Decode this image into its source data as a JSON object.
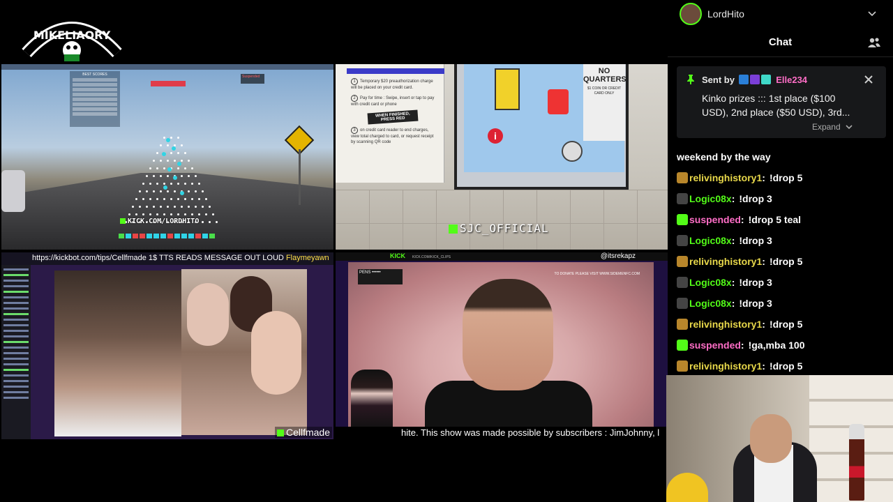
{
  "logo": {
    "text": "MIKELIAORY"
  },
  "user": {
    "name": "LordHito"
  },
  "chat": {
    "title": "Chat",
    "pinned": {
      "sent_by_label": "Sent by",
      "sender": "Elle234",
      "message": "Kinko prizes ::: 1st place ($100 USD), 2nd place ($50 USD), 3rd...",
      "expand_label": "Expand"
    },
    "messages": [
      {
        "user": "",
        "sep": "",
        "text": "weekend by the way",
        "color": "#ffffff",
        "badge": ""
      },
      {
        "user": "relivinghistory1",
        "sep": ":",
        "text": "!drop 5",
        "color": "#e8d84a",
        "badge": "#b8862b"
      },
      {
        "user": "Logic08x",
        "sep": ":",
        "text": "!drop 3",
        "color": "#53fc18",
        "badge": "#444444"
      },
      {
        "user": "suspended",
        "sep": ":",
        "text": "!drop 5 teal",
        "color": "#ff6ec7",
        "badge": "#53fc18"
      },
      {
        "user": "Logic08x",
        "sep": ":",
        "text": "!drop 3",
        "color": "#53fc18",
        "badge": "#444444"
      },
      {
        "user": "relivinghistory1",
        "sep": ":",
        "text": "!drop 5",
        "color": "#e8d84a",
        "badge": "#b8862b"
      },
      {
        "user": "Logic08x",
        "sep": ":",
        "text": "!drop 3",
        "color": "#53fc18",
        "badge": "#444444"
      },
      {
        "user": "Logic08x",
        "sep": ":",
        "text": "!drop 3",
        "color": "#53fc18",
        "badge": "#444444"
      },
      {
        "user": "relivinghistory1",
        "sep": ":",
        "text": "!drop 5",
        "color": "#e8d84a",
        "badge": "#b8862b"
      },
      {
        "user": "suspended",
        "sep": ":",
        "text": "!ga,mba 100",
        "color": "#ff6ec7",
        "badge": "#53fc18"
      },
      {
        "user": "relivinghistory1",
        "sep": ":",
        "text": "!drop 5",
        "color": "#e8d84a",
        "badge": "#b8862b"
      }
    ]
  },
  "streams": {
    "drive": {
      "overlay": "KICK.COM/LORDHITO",
      "scores_title": "BEST SCORES",
      "suspended_label": "Suspended"
    },
    "machine": {
      "tag": "SJC_OFFICIAL",
      "finished_label": "WHEN FINISHED, PRESS RED",
      "no_quarters": "NO QUARTERS",
      "coin_note": "$1 COIN OR CREDIT CARD ONLY",
      "step1": "Temporary $20 preauthorization charge will be placed on your credit card.",
      "step2": "Pay for time : Swipe, insert or tap to pay with credit card or phone",
      "step3": "on credit card reader to end charges, view total charged to card, or request receipt by scanning QR code"
    },
    "facetime": {
      "tts": "https://kickbot.com/tips/Cellfmade 1$ TTS READS MESSAGE OUT LOUD",
      "tts_name": "Flaymeyawn",
      "tag": "Cellfmade"
    },
    "soccer": {
      "kick_label": "KICK",
      "kick_url": "KICK.COM/KICK_CLIPS",
      "handle": "itsrekapz",
      "donate": "TO DONATE PLEASE VISIT WWW.SIDEMENFC.COM",
      "team": "PENS",
      "ticker": "hite. This show was made possible by subscribers : JimJohnny, l"
    }
  },
  "colors": {
    "kick_green": "#53fc18",
    "background": "#000000",
    "pinned_bg": "#17181a"
  }
}
